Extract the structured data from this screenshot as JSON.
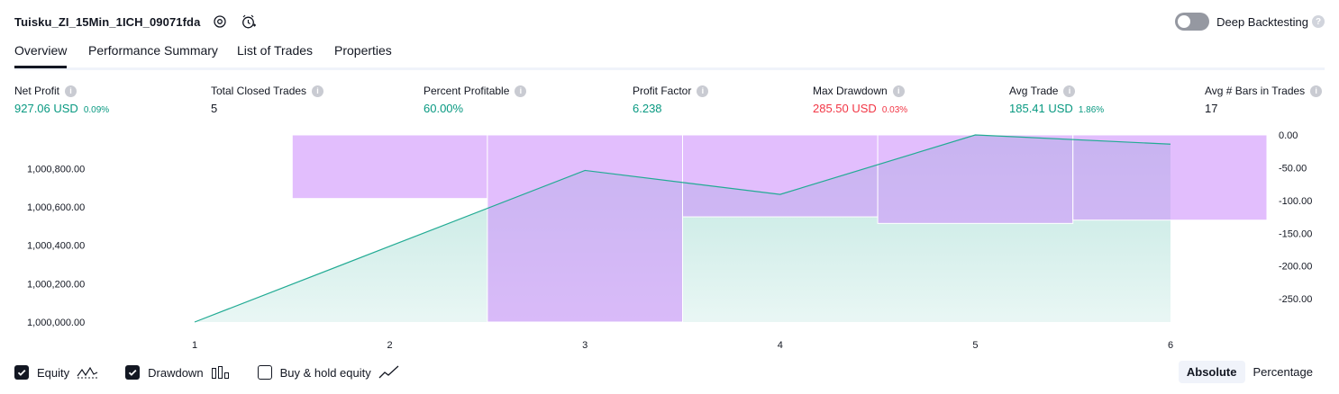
{
  "header": {
    "strategy_name": "Tuisku_ZI_15Min_1ICH_09071fda",
    "settings_icon": "gear-icon",
    "alert_icon": "alarm-clock-icon"
  },
  "deep_backtesting": {
    "label": "Deep Backtesting",
    "enabled": false,
    "help_icon": "question-icon",
    "help_glyph": "?"
  },
  "tabs": [
    {
      "label": "Overview",
      "active": true
    },
    {
      "label": "Performance Summary",
      "active": false
    },
    {
      "label": "List of Trades",
      "active": false
    },
    {
      "label": "Properties",
      "active": false
    }
  ],
  "metrics": {
    "net_profit": {
      "label": "Net Profit",
      "value": "927.06 USD",
      "pct": "0.09%"
    },
    "total_closed_trades": {
      "label": "Total Closed Trades",
      "value": "5"
    },
    "percent_profitable": {
      "label": "Percent Profitable",
      "value": "60.00%"
    },
    "profit_factor": {
      "label": "Profit Factor",
      "value": "6.238"
    },
    "max_drawdown": {
      "label": "Max Drawdown",
      "value": "285.50 USD",
      "pct": "0.03%"
    },
    "avg_trade": {
      "label": "Avg Trade",
      "value": "185.41 USD",
      "pct": "1.86%"
    },
    "avg_bars": {
      "label": "Avg # Bars in Trades",
      "value": "17"
    },
    "info_glyph": "i"
  },
  "colors": {
    "positive": "#089981",
    "negative": "#f23645",
    "equity_line": "#22ab94",
    "equity_fill": "#22ab94",
    "drawdown_fill": "#ce93fc"
  },
  "chart_data": {
    "type": "area",
    "x": [
      1,
      2,
      3,
      4,
      5,
      6
    ],
    "left_axis": {
      "ticks": [
        "1,000,800.00",
        "1,000,600.00",
        "1,000,400.00",
        "1,000,200.00",
        "1,000,000.00"
      ],
      "tick_values": [
        1000800,
        1000600,
        1000400,
        1000200,
        1000000
      ],
      "ylim": [
        1000000,
        1000975
      ]
    },
    "right_axis": {
      "ticks": [
        "0.00",
        "-50.00",
        "-100.00",
        "-150.00",
        "-200.00",
        "-250.00"
      ],
      "tick_values": [
        0,
        -50,
        -100,
        -150,
        -200,
        -250
      ],
      "ylim": [
        -285.5,
        0
      ]
    },
    "x_ticks": [
      "1",
      "2",
      "3",
      "4",
      "5",
      "6"
    ],
    "series": [
      {
        "name": "Equity",
        "axis": "left",
        "values": [
          1000000,
          1000395,
          1000790,
          1000665,
          1000975,
          1000927
        ]
      },
      {
        "name": "Drawdown",
        "axis": "right",
        "values": [
          0,
          -97,
          -285.5,
          -125,
          -135,
          -130
        ]
      }
    ],
    "grid": false,
    "legend": "bottom-left"
  },
  "footer": {
    "checkboxes": [
      {
        "label": "Equity",
        "checked": true,
        "icon": "equity-line-icon"
      },
      {
        "label": "Drawdown",
        "checked": true,
        "icon": "drawdown-bars-icon"
      },
      {
        "label": "Buy & hold equity",
        "checked": false,
        "icon": "buy-hold-line-icon"
      }
    ],
    "modes": [
      {
        "label": "Absolute",
        "active": true
      },
      {
        "label": "Percentage",
        "active": false
      }
    ]
  }
}
